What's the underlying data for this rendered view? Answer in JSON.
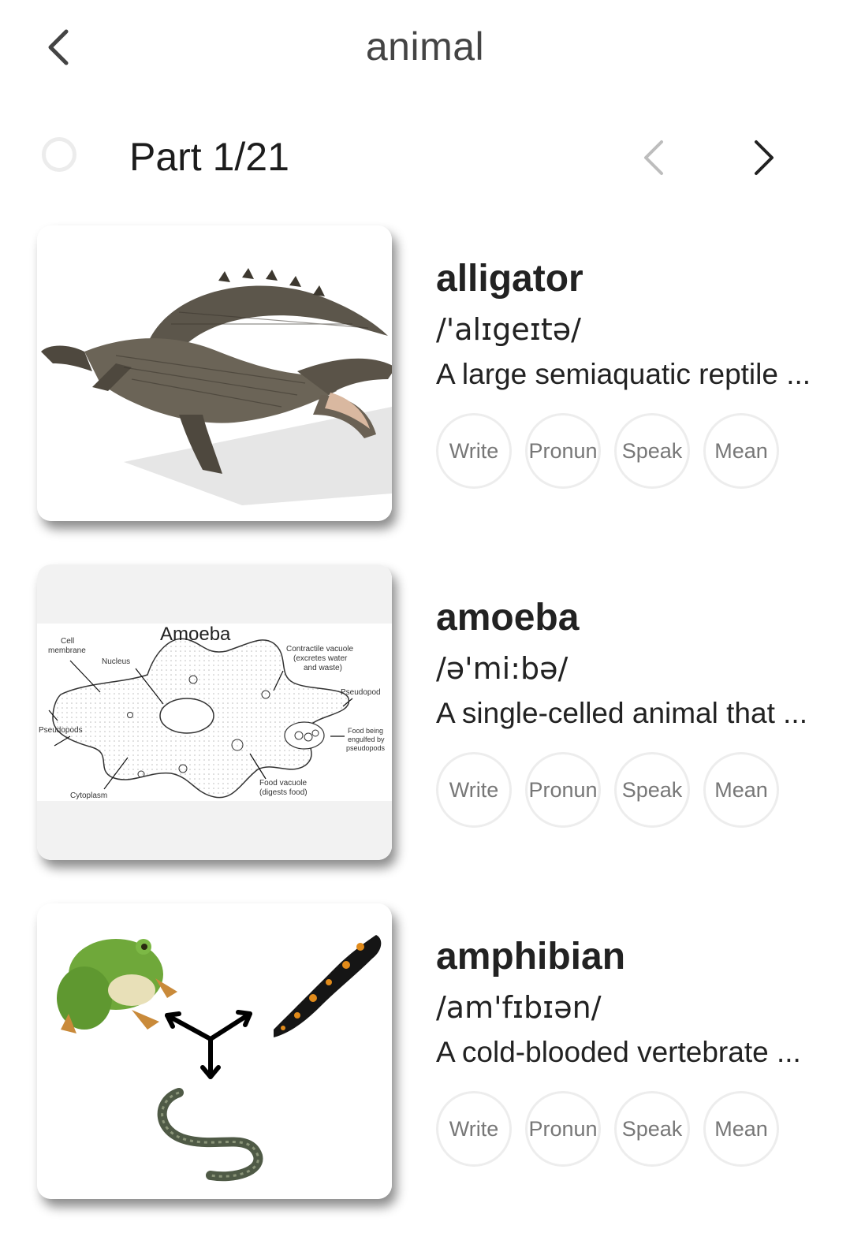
{
  "header": {
    "title": "animal"
  },
  "part": {
    "label": "Part 1/21"
  },
  "words": [
    {
      "word": "alligator",
      "phonetic": "/'alɪgeɪtə/",
      "definition": "A large semiaquatic reptile ...",
      "actions": [
        "Write",
        "Pronun",
        "Speak",
        "Mean"
      ]
    },
    {
      "word": "amoeba",
      "phonetic": "/ə'mi:bə/",
      "definition": "A single-celled animal that ...",
      "actions": [
        "Write",
        "Pronun",
        "Speak",
        "Mean"
      ],
      "image_labels": {
        "title": "Amoeba",
        "cell_membrane_1": "Cell",
        "cell_membrane_2": "membrane",
        "nucleus": "Nucleus",
        "contractile_1": "Contractile vacuole",
        "contractile_2": "(excretes water",
        "contractile_3": "and waste)",
        "pseudopod": "Pseudopod",
        "pseudopods": "Pseudopods",
        "food_engulfed_1": "Food being",
        "food_engulfed_2": "engulfed by",
        "food_engulfed_3": "pseudopods",
        "cytoplasm": "Cytoplasm",
        "food_vacuole_1": "Food vacuole",
        "food_vacuole_2": "(digests food)"
      }
    },
    {
      "word": "amphibian",
      "phonetic": "/am'fɪbɪən/",
      "definition": "A cold-blooded vertebrate ...",
      "actions": [
        "Write",
        "Pronun",
        "Speak",
        "Mean"
      ]
    }
  ],
  "colors": {
    "accent_text": "#222222",
    "muted": "#777777",
    "pill_border": "#ededed"
  },
  "icons": {
    "back": "chevron-left-icon",
    "prev": "chevron-left-icon",
    "next": "chevron-right-icon"
  }
}
